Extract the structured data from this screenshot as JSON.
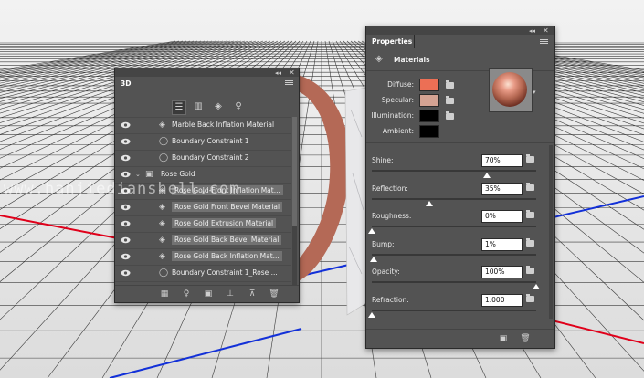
{
  "watermark": "www.hanjiedianshell.com",
  "panel_3d": {
    "title": "3D",
    "rows": [
      {
        "label": "Marble Back Inflation Material",
        "kind": "material",
        "visible": true,
        "highlight": false,
        "indent": 1
      },
      {
        "label": "Boundary Constraint 1",
        "kind": "constraint",
        "visible": true,
        "highlight": false,
        "indent": 1
      },
      {
        "label": "Boundary Constraint 2",
        "kind": "constraint",
        "visible": true,
        "highlight": false,
        "indent": 1
      },
      {
        "label": "Rose Gold",
        "kind": "mesh",
        "visible": true,
        "highlight": false,
        "indent": 0
      },
      {
        "label": "Rose Gold-Front Inflation Mat...",
        "kind": "material",
        "visible": true,
        "highlight": true,
        "indent": 1
      },
      {
        "label": "Rose Gold Front Bevel Material",
        "kind": "material",
        "visible": true,
        "highlight": true,
        "indent": 1
      },
      {
        "label": "Rose Gold Extrusion Material",
        "kind": "material",
        "visible": true,
        "highlight": true,
        "indent": 1
      },
      {
        "label": "Rose Gold Back Bevel Material",
        "kind": "material",
        "visible": true,
        "highlight": true,
        "indent": 1
      },
      {
        "label": "Rose Gold Back Inflation Mat...",
        "kind": "material",
        "visible": true,
        "highlight": true,
        "indent": 1
      },
      {
        "label": "Boundary Constraint 1_Rose ...",
        "kind": "constraint",
        "visible": true,
        "highlight": false,
        "indent": 1
      },
      {
        "label": "Boundary Constraint 2_Rose ...",
        "kind": "constraint",
        "visible": true,
        "highlight": false,
        "indent": 1
      }
    ]
  },
  "properties": {
    "title": "Properties",
    "section": "Materials",
    "swatches": [
      {
        "label": "Diffuse:",
        "color": "#ec6f55"
      },
      {
        "label": "Specular:",
        "color": "#d4a393"
      },
      {
        "label": "Illumination:",
        "color": "#000000"
      },
      {
        "label": "Ambient:",
        "color": "#000000"
      }
    ],
    "props": [
      {
        "label": "Shine:",
        "value": "70%",
        "level": 0.7
      },
      {
        "label": "Reflection:",
        "value": "35%",
        "level": 0.35
      },
      {
        "label": "Roughness:",
        "value": "0%",
        "level": 0.0
      },
      {
        "label": "Bump:",
        "value": "1%",
        "level": 0.01
      },
      {
        "label": "Opacity:",
        "value": "100%",
        "level": 1.0
      },
      {
        "label": "Refraction:",
        "value": "1.000",
        "level": 0.0
      }
    ]
  },
  "colors": {
    "panel": "#535353",
    "panel_dark": "#454545",
    "highlight_row": "#727272",
    "grid": "#3a3a3a",
    "axis_red": "#e0001a",
    "axis_blue": "#1230d8"
  }
}
